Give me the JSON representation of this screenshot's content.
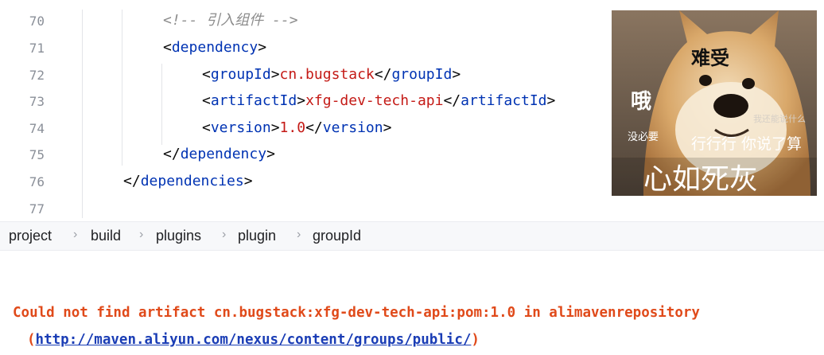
{
  "editor": {
    "line_numbers": [
      "70",
      "71",
      "72",
      "73",
      "74",
      "75",
      "76",
      "77"
    ],
    "lines": [
      {
        "comment": "<!-- 引入组件 -->"
      },
      {
        "open": "<",
        "tag": "dependency",
        "close": ">"
      },
      {
        "open": "<",
        "tag": "groupId",
        "mid": ">",
        "value": "cn.bugstack",
        "end_open": "</",
        "end_tag": "groupId",
        "end_close": ">"
      },
      {
        "open": "<",
        "tag": "artifactId",
        "mid": ">",
        "value": "xfg-dev-tech-api",
        "end_open": "</",
        "end_tag": "artifactId",
        "end_close": ">"
      },
      {
        "open": "<",
        "tag": "version",
        "mid": ">",
        "value": "1.0",
        "end_open": "</",
        "end_tag": "version",
        "end_close": ">"
      },
      {
        "open": "</",
        "tag": "dependency",
        "close": ">"
      },
      {
        "open": "</",
        "tag": "dependencies",
        "close": ">"
      },
      {}
    ]
  },
  "meme": {
    "texts": {
      "t1": "难受",
      "t2": "哦",
      "t3": "没必要",
      "t4": "我还能说什么",
      "t5": "行行行 你说了算",
      "t6": "心如死灰"
    }
  },
  "breadcrumb": {
    "items": [
      "project",
      "build",
      "plugins",
      "plugin",
      "groupId"
    ],
    "separator": "›"
  },
  "console": {
    "error_line1": "Could not find artifact cn.bugstack:xfg-dev-tech-api:pom:1.0 in alimavenrepository",
    "error_open_paren": "(",
    "error_link": "http://maven.aliyun.com/nexus/content/groups/public/",
    "error_close_paren": ")"
  },
  "colors": {
    "tag": "#0033b3",
    "value": "#c41a16",
    "comment": "#8c8c8c",
    "error": "#e04a1a",
    "link": "#1a3db5"
  }
}
